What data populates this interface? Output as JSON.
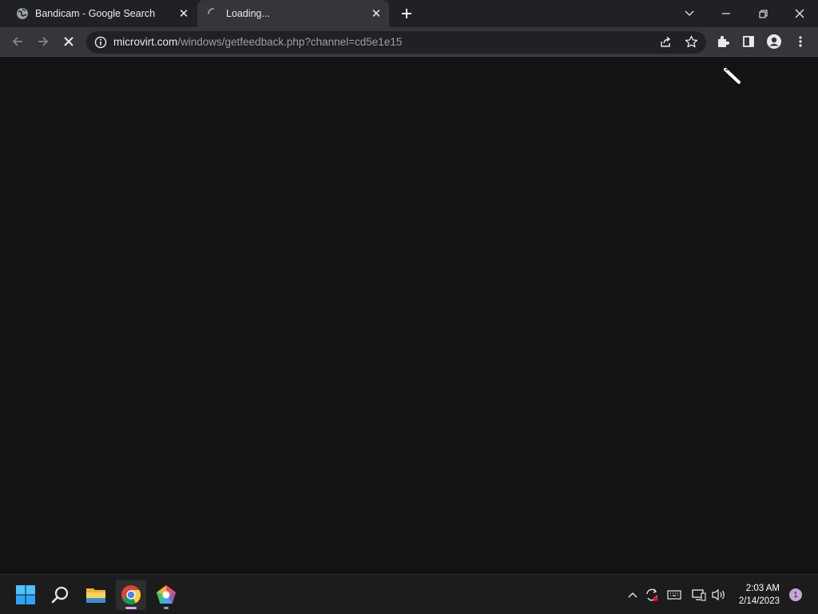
{
  "browser": {
    "tabs": [
      {
        "title": "Bandicam - Google Search",
        "favicon": "globe-icon",
        "active": false
      },
      {
        "title": "Loading...",
        "favicon": "spinner-icon",
        "active": true
      }
    ],
    "address": {
      "host": "microvirt.com",
      "path": "/windows/getfeedback.php?channel=cd5e1e15"
    },
    "toolbar": {
      "back": "arrow-left-icon",
      "forward": "arrow-right-icon",
      "stop": "close-icon"
    }
  },
  "taskbar": {
    "apps": [
      "windows-start-icon",
      "search-icon",
      "file-explorer-icon",
      "chrome-icon",
      "memu-icon"
    ],
    "clock": {
      "time": "2:03 AM",
      "date": "2/14/2023"
    },
    "notification_count": "1"
  },
  "colors": {
    "page_bg": "#131313",
    "chrome_dark": "#202124",
    "chrome_toolbar": "#35363a",
    "accent": "#8ab4f8"
  }
}
